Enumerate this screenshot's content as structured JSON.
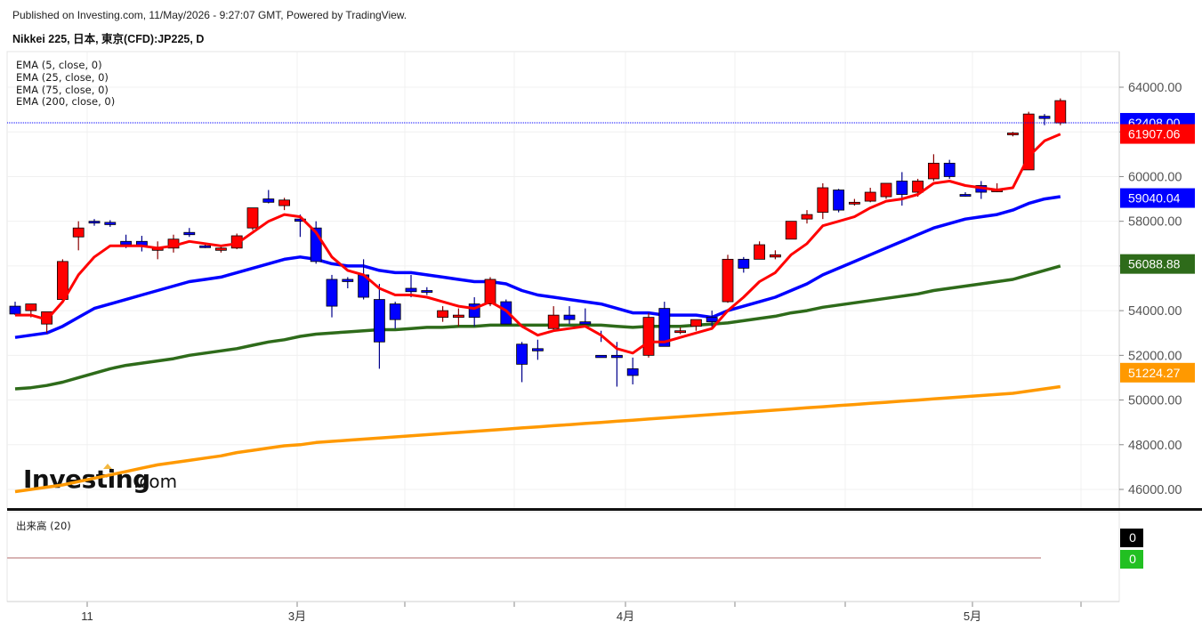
{
  "header": {
    "published": "Published on Investing.com, 11/May/2026 - 9:27:07 GMT, Powered by TradingView.",
    "instrument": "Nikkei 225, 日本, 東京(CFD):JP225, D"
  },
  "logo": {
    "main": "Investing",
    "domain": ".com"
  },
  "colors": {
    "up_candle": "#ff0000",
    "down_candle": "#0000ff",
    "ema5": "#ff0000",
    "ema25": "#0000ff",
    "ema75": "#2e6b1a",
    "ema200": "#ff9900",
    "price_line": "#0000ff"
  },
  "chart_data": [
    {
      "type": "candlestick",
      "title": "Nikkei 225, 日本, 東京(CFD):JP225, D",
      "indicators": [
        "EMA (5, close, 0)",
        "EMA (25, close, 0)",
        "EMA (75, close, 0)",
        "EMA (200, close, 0)"
      ],
      "x_ticks": [
        "11",
        "3月",
        "4月",
        "5月"
      ],
      "y_ticks": [
        "64000.00",
        "62000.00",
        "60000.00",
        "58000.00",
        "56000.00",
        "54000.00",
        "52000.00",
        "50000.00",
        "48000.00",
        "46000.00"
      ],
      "ylim": [
        45000,
        65000
      ],
      "last_price": "62408.00",
      "value_tags": [
        "62408.00",
        "61907.06",
        "59040.04",
        "56088.88",
        "51224.27"
      ],
      "candles": [
        [
          54200,
          54400,
          53800,
          53850
        ],
        [
          54000,
          54300,
          53700,
          54300
        ],
        [
          53400,
          53950,
          53000,
          53950
        ],
        [
          54500,
          56300,
          54400,
          56200
        ],
        [
          57300,
          58000,
          56700,
          57700
        ],
        [
          58000,
          58100,
          57800,
          57950
        ],
        [
          57950,
          58050,
          57750,
          57850
        ],
        [
          57100,
          57400,
          56800,
          56950
        ],
        [
          57100,
          57350,
          56650,
          56900
        ],
        [
          56700,
          57100,
          56300,
          56800
        ],
        [
          56800,
          57400,
          56600,
          57200
        ],
        [
          57500,
          57700,
          57300,
          57400
        ],
        [
          56900,
          57050,
          56800,
          56850
        ],
        [
          56700,
          56850,
          56600,
          56800
        ],
        [
          56800,
          57450,
          56750,
          57350
        ],
        [
          57700,
          58600,
          57600,
          58600
        ],
        [
          59000,
          59400,
          58800,
          58850
        ],
        [
          58700,
          59050,
          58500,
          58950
        ],
        [
          58100,
          58300,
          57300,
          58000
        ],
        [
          57700,
          58000,
          56100,
          56200
        ],
        [
          55400,
          55600,
          53700,
          54200
        ],
        [
          55400,
          55500,
          55000,
          55300
        ],
        [
          55600,
          56300,
          54500,
          54600
        ],
        [
          54500,
          55200,
          51400,
          52600
        ],
        [
          54300,
          54400,
          53200,
          53600
        ],
        [
          55000,
          55600,
          54600,
          54850
        ],
        [
          54900,
          55050,
          54700,
          54850
        ],
        [
          53700,
          54200,
          53500,
          54000
        ],
        [
          53700,
          54100,
          53300,
          53800
        ],
        [
          54300,
          54600,
          53300,
          53700
        ],
        [
          54300,
          55500,
          54200,
          55400
        ],
        [
          54400,
          54500,
          53400,
          53400
        ],
        [
          52500,
          52600,
          50800,
          51600
        ],
        [
          52300,
          52700,
          51800,
          52200
        ],
        [
          53200,
          54200,
          53100,
          53800
        ],
        [
          53800,
          54200,
          53400,
          53600
        ],
        [
          53500,
          54100,
          53400,
          53400
        ],
        [
          52000,
          53100,
          52600,
          51900
        ],
        [
          52000,
          52600,
          50600,
          51900
        ],
        [
          51400,
          51900,
          50700,
          51100
        ],
        [
          52000,
          53900,
          51900,
          53700
        ],
        [
          54100,
          54400,
          52400,
          52400
        ],
        [
          53100,
          53250,
          52950,
          53100
        ],
        [
          53300,
          53500,
          53100,
          53600
        ],
        [
          53700,
          54000,
          53200,
          53500
        ],
        [
          54400,
          56500,
          54350,
          56300
        ],
        [
          56300,
          56400,
          55700,
          55900
        ],
        [
          56300,
          57100,
          56300,
          56950
        ],
        [
          56400,
          56700,
          56300,
          56500
        ],
        [
          57200,
          58000,
          57200,
          58000
        ],
        [
          58100,
          58500,
          57900,
          58300
        ],
        [
          58400,
          59700,
          58100,
          59500
        ],
        [
          59400,
          59450,
          58400,
          58500
        ],
        [
          58800,
          59000,
          58700,
          58850
        ],
        [
          58900,
          59500,
          58850,
          59300
        ],
        [
          59100,
          59700,
          59000,
          59700
        ],
        [
          59800,
          60200,
          58700,
          59200
        ],
        [
          59300,
          59900,
          59100,
          59800
        ],
        [
          59900,
          61000,
          59800,
          60600
        ],
        [
          60600,
          60750,
          59900,
          60000
        ],
        [
          59200,
          59300,
          59100,
          59150
        ],
        [
          59600,
          59800,
          59000,
          59300
        ],
        [
          59400,
          59700,
          59300,
          59400
        ],
        [
          61950,
          62000,
          61800,
          61950
        ],
        [
          60300,
          62900,
          60300,
          62800
        ],
        [
          62700,
          62800,
          62300,
          62600
        ],
        [
          62400,
          63500,
          62300,
          63400
        ]
      ],
      "ema5": [
        53800,
        53800,
        53600,
        54400,
        55600,
        56400,
        56900,
        56900,
        56900,
        56800,
        56900,
        57100,
        57000,
        56900,
        57000,
        57500,
        58000,
        58300,
        58200,
        57500,
        56400,
        55800,
        55600,
        55000,
        54700,
        54700,
        54600,
        54400,
        54200,
        54100,
        54400,
        54000,
        53300,
        52900,
        53100,
        53200,
        53300,
        52900,
        52300,
        52100,
        52600,
        52600,
        52800,
        53000,
        53200,
        54000,
        54600,
        55300,
        55700,
        56500,
        57000,
        57800,
        58000,
        58200,
        58600,
        58900,
        59000,
        59200,
        59700,
        59800,
        59600,
        59500,
        59400,
        59500,
        60900,
        61600,
        61900
      ],
      "ema25": [
        52800,
        52900,
        53000,
        53300,
        53700,
        54100,
        54300,
        54500,
        54700,
        54900,
        55100,
        55300,
        55400,
        55500,
        55700,
        55900,
        56100,
        56300,
        56400,
        56300,
        56100,
        56000,
        56000,
        55800,
        55700,
        55700,
        55600,
        55500,
        55400,
        55300,
        55300,
        55200,
        54900,
        54700,
        54600,
        54500,
        54400,
        54300,
        54100,
        53900,
        53900,
        53800,
        53800,
        53800,
        53700,
        54000,
        54200,
        54400,
        54600,
        54900,
        55200,
        55600,
        55900,
        56200,
        56500,
        56800,
        57100,
        57400,
        57700,
        57900,
        58100,
        58200,
        58300,
        58500,
        58800,
        59000,
        59100
      ],
      "ema75": [
        50500,
        50550,
        50650,
        50800,
        51000,
        51200,
        51400,
        51550,
        51650,
        51750,
        51850,
        52000,
        52100,
        52200,
        52300,
        52450,
        52600,
        52700,
        52850,
        52950,
        53000,
        53050,
        53100,
        53150,
        53150,
        53200,
        53250,
        53250,
        53300,
        53300,
        53350,
        53350,
        53350,
        53350,
        53350,
        53350,
        53350,
        53350,
        53300,
        53250,
        53300,
        53300,
        53300,
        53350,
        53400,
        53450,
        53550,
        53650,
        53750,
        53900,
        54000,
        54150,
        54250,
        54350,
        54450,
        54550,
        54650,
        54750,
        54900,
        55000,
        55100,
        55200,
        55300,
        55400,
        55600,
        55800,
        56000
      ],
      "ema200": [
        45900,
        46000,
        46100,
        46200,
        46350,
        46500,
        46650,
        46800,
        46950,
        47100,
        47200,
        47300,
        47400,
        47500,
        47650,
        47750,
        47850,
        47950,
        48000,
        48100,
        48150,
        48200,
        48250,
        48300,
        48350,
        48400,
        48450,
        48500,
        48550,
        48600,
        48650,
        48700,
        48750,
        48800,
        48850,
        48900,
        48950,
        49000,
        49050,
        49100,
        49150,
        49200,
        49250,
        49300,
        49350,
        49400,
        49450,
        49500,
        49550,
        49600,
        49650,
        49700,
        49750,
        49800,
        49850,
        49900,
        49950,
        50000,
        50050,
        50100,
        50150,
        50200,
        50250,
        50300,
        50400,
        50500,
        50600
      ]
    },
    {
      "type": "bar",
      "title": "出来高 (20)",
      "value_tags": [
        "0",
        "0"
      ],
      "values": []
    }
  ]
}
